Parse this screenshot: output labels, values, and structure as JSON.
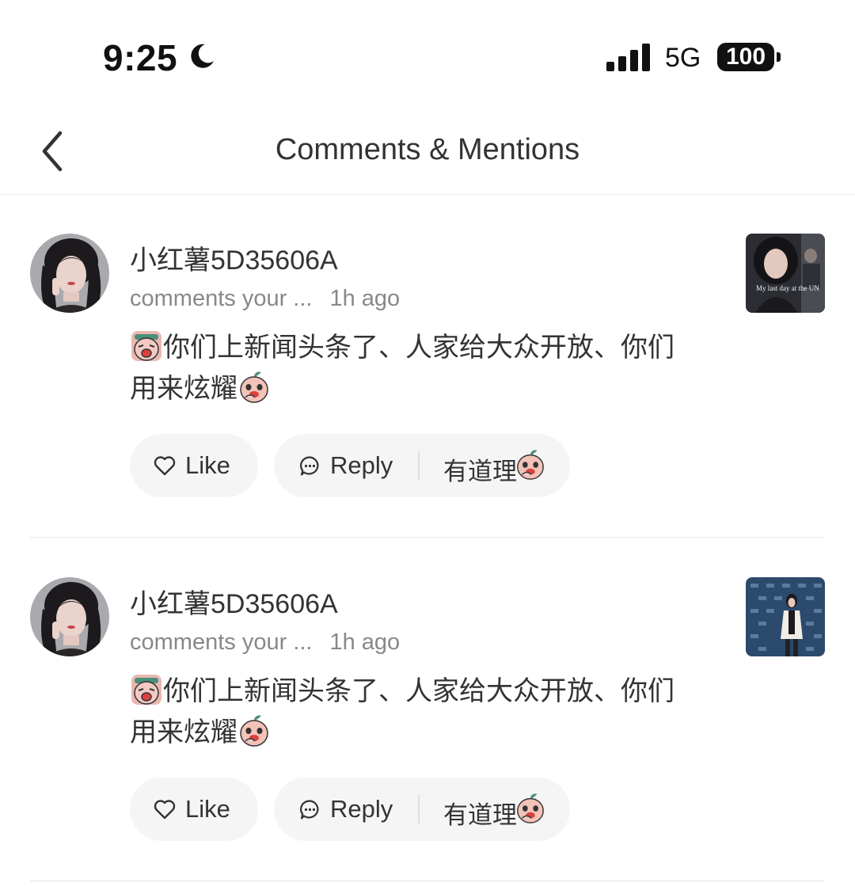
{
  "status_bar": {
    "time": "9:25",
    "network": "5G",
    "battery": "100",
    "icons": [
      "moon-icon",
      "signal-icon",
      "battery-icon"
    ]
  },
  "header": {
    "title": "Comments & Mentions",
    "back_icon": "chevron-left-icon"
  },
  "notifications": [
    {
      "user_name": "小红薯5D35606A",
      "action": "comments your ...",
      "time_ago": "1h ago",
      "comment_line1": "你们上新闻头条了、人家给大众开放、你们",
      "comment_line2": "用来炫耀",
      "thumbnail_caption": "My last day at the UN",
      "like_label": "Like",
      "reply_label": "Reply",
      "quick_reply_label": "有道理"
    },
    {
      "user_name": "小红薯5D35606A",
      "action": "comments your ...",
      "time_ago": "1h ago",
      "comment_line1": "你们上新闻头条了、人家给大众开放、你们",
      "comment_line2": "用来炫耀",
      "like_label": "Like",
      "reply_label": "Reply",
      "quick_reply_label": "有道理"
    }
  ],
  "colors": {
    "text_primary": "#333333",
    "text_secondary": "#888888",
    "button_bg": "#f5f5f5",
    "divider": "#e8e8e8"
  }
}
